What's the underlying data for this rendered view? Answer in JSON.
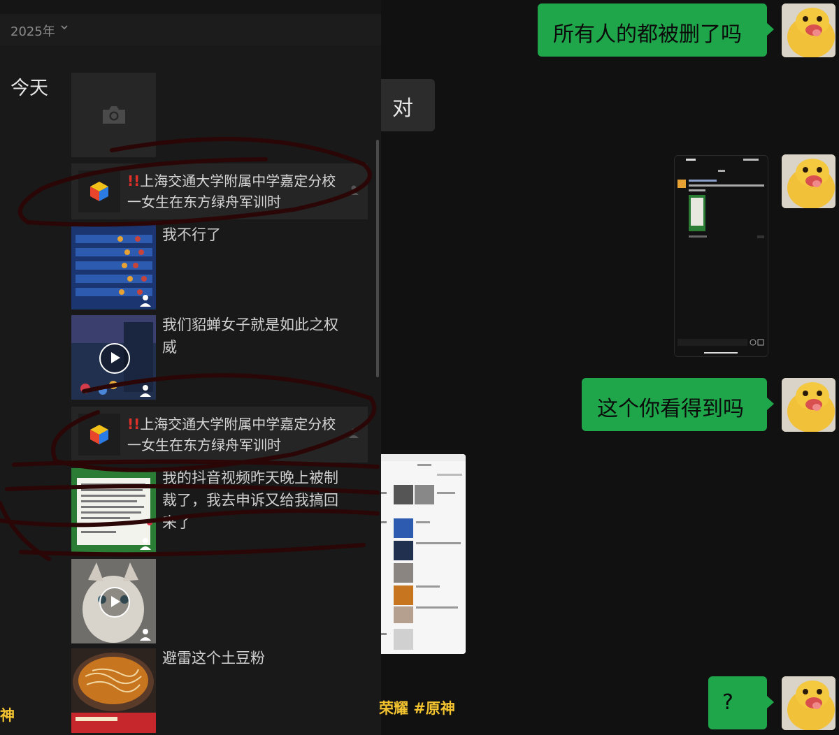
{
  "left": {
    "year": "2025年",
    "day": "今天",
    "link_card_1": {
      "bang": "!!",
      "title": "上海交通大学附属中学嘉定分校一女生在东方绿舟军训时"
    },
    "post_1": "我不行了",
    "post_2": "我们貂蝉女子就是如此之权威",
    "link_card_2": {
      "bang": "!!",
      "title": "上海交通大学附属中学嘉定分校一女生在东方绿舟军训时"
    },
    "post_3": "我的抖音视频昨天晚上被制裁了，我去申诉又给我搞回来了",
    "post_4": "避雷这个土豆粉",
    "hashtag_partial": "神"
  },
  "chat": {
    "reply": "对",
    "msg_1": "所有人的都被删了吗",
    "msg_2": "这个你看得到吗",
    "msg_3": "?"
  },
  "footer": {
    "hashtags": "荣耀 #原神"
  },
  "colors": {
    "green_bubble": "#1fa64a",
    "hashtag": "#f4c430",
    "scribble": "#2a0606"
  }
}
